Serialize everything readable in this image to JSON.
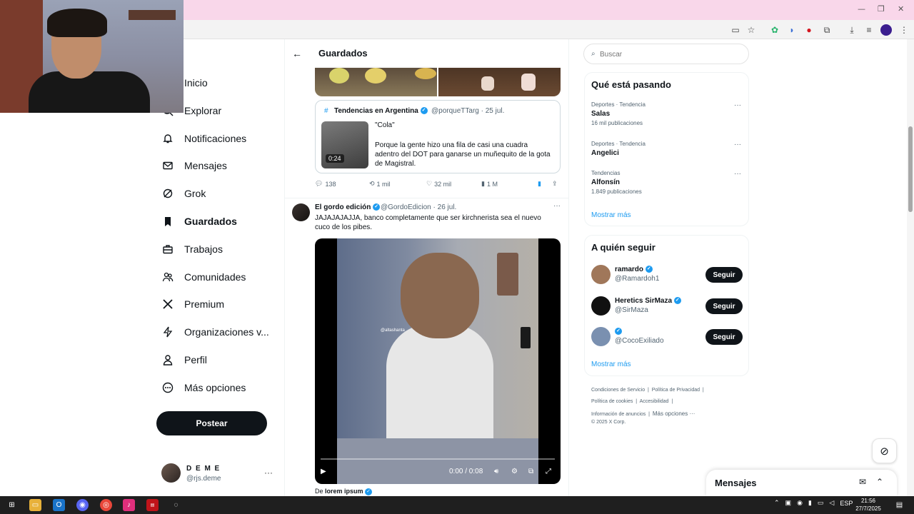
{
  "nav": {
    "items": [
      {
        "label": "Inicio",
        "icon": "home-icon"
      },
      {
        "label": "Explorar",
        "icon": "search-icon"
      },
      {
        "label": "Notificaciones",
        "icon": "bell-icon"
      },
      {
        "label": "Mensajes",
        "icon": "mail-icon"
      },
      {
        "label": "Grok",
        "icon": "grok-icon"
      },
      {
        "label": "Guardados",
        "icon": "bookmark-icon",
        "active": true
      },
      {
        "label": "Trabajos",
        "icon": "briefcase-icon"
      },
      {
        "label": "Comunidades",
        "icon": "people-icon"
      },
      {
        "label": "Premium",
        "icon": "x-logo-icon"
      },
      {
        "label": "Organizaciones v...",
        "icon": "lightning-icon"
      },
      {
        "label": "Perfil",
        "icon": "person-icon"
      },
      {
        "label": "Más opciones",
        "icon": "more-circle-icon"
      }
    ],
    "post_label": "Postear",
    "profile": {
      "name": "D E M E",
      "handle": "@rjs.deme"
    }
  },
  "center": {
    "header_title": "Guardados",
    "quote": {
      "hashtag": "#",
      "name": "Tendencias en Argentina",
      "handle": "@porqueTTarg · 25 jul.",
      "duration": "0:24",
      "text1": "\"Cola\"",
      "text2": "Porque la gente hizo una fila de casi una cuadra adentro del DOT para ganarse un muñequito de la gota de Magistral."
    },
    "actions": {
      "replies": "138",
      "reposts": "1 mil",
      "likes": "32 mil",
      "views": "1 M"
    },
    "tweet2": {
      "name": "El gordo edición",
      "handle": "@GordoEdicion · 26 jul.",
      "text": "JAJAJAJAJJA, banco completamente que ser kirchnerista sea el nuevo cuco de los pibes.",
      "time": "0:00 / 0:08",
      "watermark": "@altashanta"
    },
    "tweet3": {
      "prefix": "De",
      "name": "lorem ipsum"
    }
  },
  "right": {
    "search_placeholder": "Buscar",
    "trends_title": "Qué está pasando",
    "trends": [
      {
        "category": "Deportes · Tendencia",
        "name": "Salas",
        "posts": "16 mil publicaciones"
      },
      {
        "category": "Deportes · Tendencia",
        "name": "Angelici",
        "posts": ""
      },
      {
        "category": "Tendencias",
        "name": "Alfonsín",
        "posts": "1.849 publicaciones"
      }
    ],
    "show_more": "Mostrar más",
    "follow_title": "A quién seguir",
    "follow": [
      {
        "name": "ramardo",
        "handle": "@Ramardoh1",
        "button": "Seguir",
        "avatar_color": "#a0775a"
      },
      {
        "name": "Heretics SirMaza",
        "handle": "@SirMaza",
        "button": "Seguir",
        "avatar_color": "#111111"
      },
      {
        "name": "",
        "handle": "@CocoExiliado",
        "button": "Seguir",
        "avatar_color": "#7a90b0"
      }
    ],
    "footer": [
      [
        "Condiciones de Servicio",
        "Política de Privacidad"
      ],
      [
        "Política de cookies",
        "Accesibilidad"
      ],
      [
        "Información de anuncios",
        "Más opciones ···"
      ],
      [
        "© 2025 X Corp."
      ]
    ]
  },
  "messages_drawer": {
    "title": "Mensajes"
  },
  "taskbar": {
    "lang": "ESP",
    "time": "21:56",
    "date": "27/7/2025"
  },
  "colors": {
    "accent": "#1d9bf0",
    "text": "#0f1419",
    "muted": "#536471",
    "titlebar": "#f9d7ea"
  }
}
